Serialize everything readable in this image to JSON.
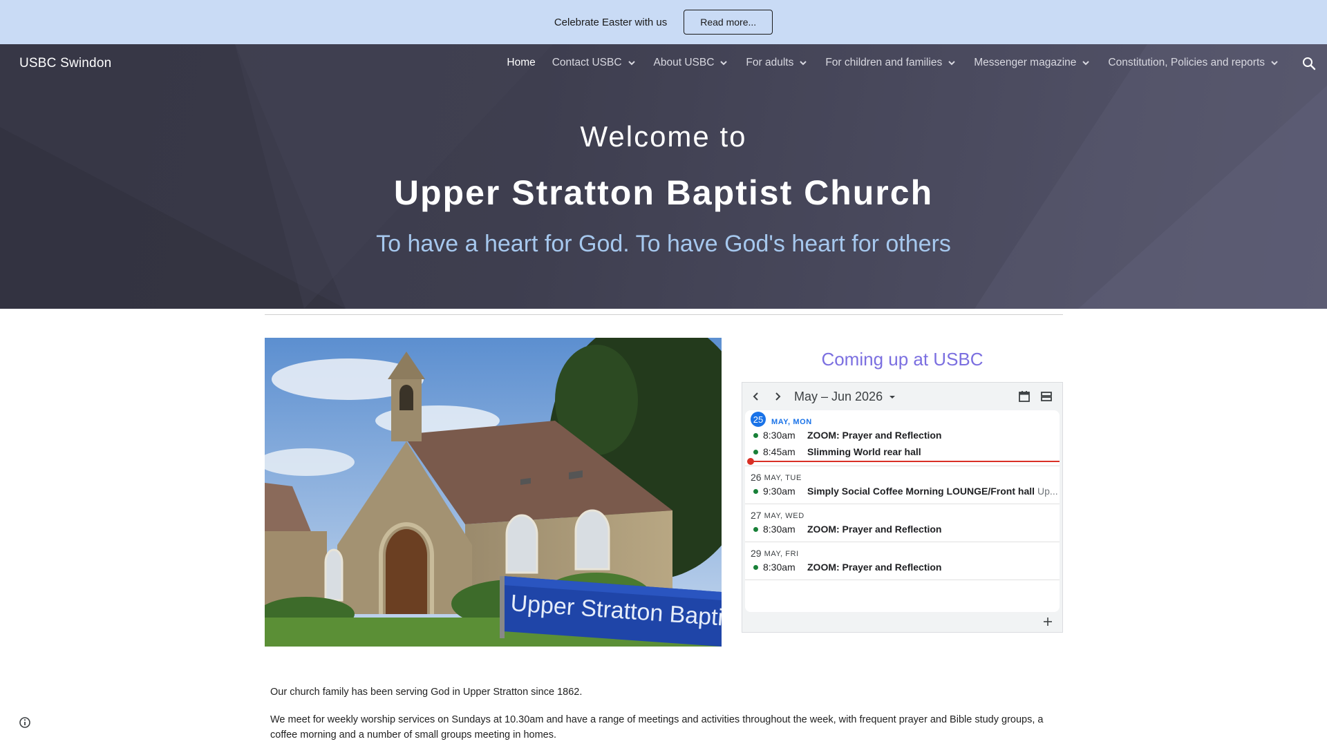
{
  "banner": {
    "text": "Celebrate Easter with us",
    "button_label": "Read more..."
  },
  "header": {
    "site_title": "USBC Swindon",
    "nav": [
      {
        "label": "Home",
        "active": true,
        "has_menu": false
      },
      {
        "label": "Contact USBC",
        "active": false,
        "has_menu": true
      },
      {
        "label": "About USBC",
        "active": false,
        "has_menu": true
      },
      {
        "label": "For adults",
        "active": false,
        "has_menu": true
      },
      {
        "label": "For children and families",
        "active": false,
        "has_menu": true
      },
      {
        "label": "Messenger magazine",
        "active": false,
        "has_menu": true
      },
      {
        "label": "Constitution, Policies and reports",
        "active": false,
        "has_menu": true
      }
    ],
    "search_icon": "search-icon"
  },
  "hero": {
    "welcome": "Welcome to",
    "title": "Upper Stratton Baptist Church",
    "subtitle": "To have a heart for God. To have God's heart for others"
  },
  "photo": {
    "sign_text": "Upper Stratton Baptist Church"
  },
  "calendar": {
    "heading": "Coming up at USBC",
    "range": "May – Jun 2026",
    "days": [
      {
        "num": "25",
        "label": "MAY, MON",
        "today": true,
        "events": [
          {
            "time": "8:30am",
            "title": "ZOOM: Prayer and Reflection",
            "extra": ""
          },
          {
            "time": "8:45am",
            "title": "Slimming World rear hall",
            "extra": ""
          }
        ]
      },
      {
        "num": "26",
        "label": "MAY, TUE",
        "today": false,
        "events": [
          {
            "time": "9:30am",
            "title": "Simply Social Coffee Morning LOUNGE/Front hall",
            "extra": "Up..."
          }
        ]
      },
      {
        "num": "27",
        "label": "MAY, WED",
        "today": false,
        "events": [
          {
            "time": "8:30am",
            "title": "ZOOM: Prayer and Reflection",
            "extra": ""
          }
        ]
      },
      {
        "num": "29",
        "label": "MAY, FRI",
        "today": false,
        "events": [
          {
            "time": "8:30am",
            "title": "ZOOM: Prayer and Reflection",
            "extra": ""
          }
        ]
      }
    ],
    "colors": {
      "today": "#1a73e8",
      "event_dot": "#188038",
      "now_line": "#d93025"
    }
  },
  "content": {
    "para1": "Our church family has been serving God in Upper Stratton since 1862.",
    "para2": "We meet for weekly worship services on Sundays at 10.30am and have a range of meetings and activities throughout the week, with frequent prayer and Bible study groups, a coffee morning and a number of small groups meeting in homes."
  },
  "colors": {
    "banner_bg": "#c9dbf5",
    "hero_subtitle": "#a6c8ee",
    "cal_heading": "#7b6fe0"
  }
}
